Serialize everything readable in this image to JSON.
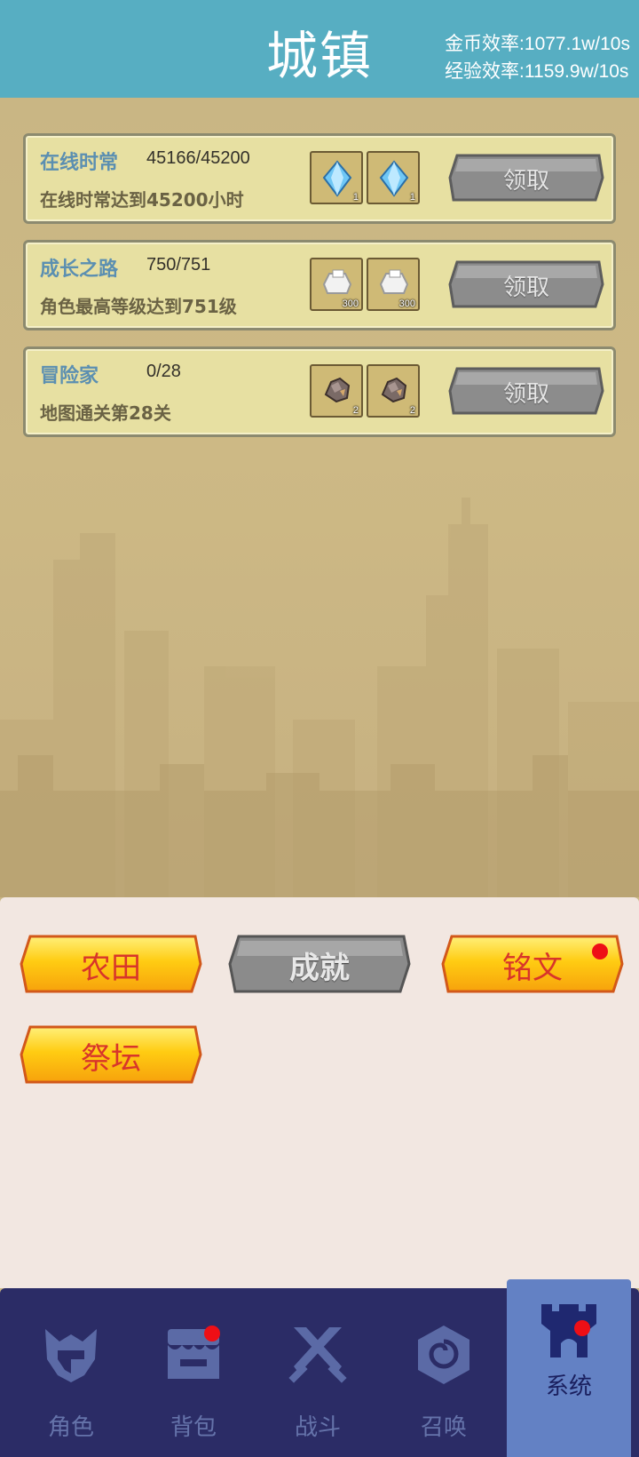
{
  "header": {
    "title": "城镇",
    "gold_rate": "金币效率:1077.1w/10s",
    "exp_rate": "经验效率:1159.9w/10s"
  },
  "tasks": [
    {
      "name": "在线时常",
      "progress": "45166/45200",
      "desc": "在线时常达到45200小时",
      "rewards": [
        {
          "icon": "blue-crystal-icon",
          "count": "1"
        },
        {
          "icon": "blue-crystal-icon",
          "count": "1"
        }
      ],
      "claim_label": "领取"
    },
    {
      "name": "成长之路",
      "progress": "750/751",
      "desc": "角色最高等级达到751级",
      "rewards": [
        {
          "icon": "silver-ingot-icon",
          "count": "300"
        },
        {
          "icon": "silver-ingot-icon",
          "count": "300"
        }
      ],
      "claim_label": "领取"
    },
    {
      "name": "冒险家",
      "progress": "0/28",
      "desc": "地图通关第28关",
      "rewards": [
        {
          "icon": "ore-icon",
          "count": "2"
        },
        {
          "icon": "ore-icon",
          "count": "2"
        }
      ],
      "claim_label": "领取"
    }
  ],
  "system_buttons": [
    {
      "label": "农田",
      "state": "active",
      "badge": false
    },
    {
      "label": "成就",
      "state": "disabled",
      "badge": false
    },
    {
      "label": "铭文",
      "state": "active",
      "badge": true
    },
    {
      "label": "祭坛",
      "state": "active",
      "badge": false
    }
  ],
  "nav": [
    {
      "label": "角色",
      "icon": "helmet-icon",
      "badge": false
    },
    {
      "label": "背包",
      "icon": "shop-icon",
      "badge": true
    },
    {
      "label": "战斗",
      "icon": "crossed-swords-icon",
      "badge": false
    },
    {
      "label": "召唤",
      "icon": "spiral-icon",
      "badge": false
    },
    {
      "label": "系统",
      "icon": "castle-icon",
      "badge": true,
      "active": true
    }
  ],
  "colors": {
    "header": "#57aec2",
    "task_bg": "#e7e0a2",
    "task_name": "#5b8fb1",
    "button_gold": "#f9b80f",
    "button_gray": "#8c8c8c",
    "nav_bg": "#2b2c66",
    "nav_active": "#6381c4",
    "badge": "#ee0f16"
  }
}
